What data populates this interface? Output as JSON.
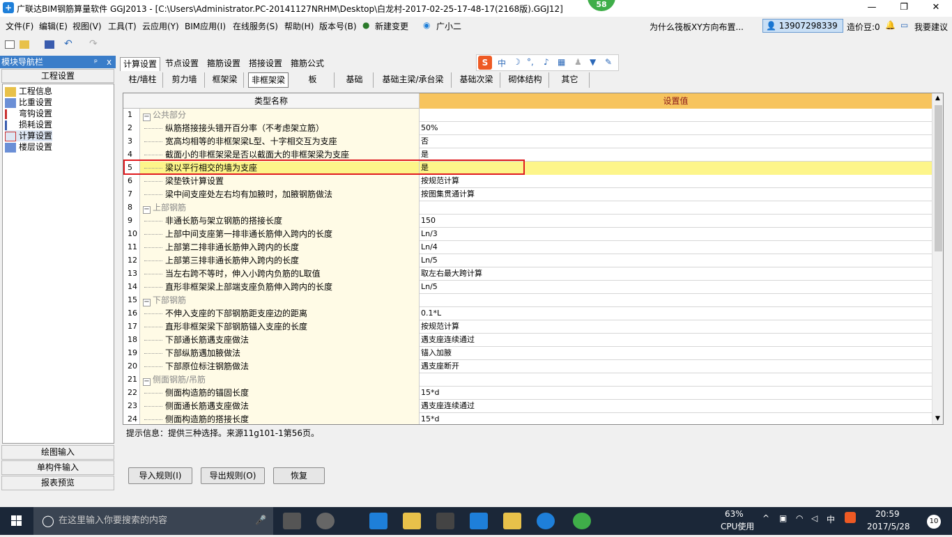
{
  "window": {
    "title": "广联达BIM钢筋算量软件 GGJ2013 - [C:\\Users\\Administrator.PC-20141127NRHM\\Desktop\\白龙村-2017-02-25-17-48-17(2168版).GGJ12]",
    "badge": "58",
    "minimize": "—",
    "maximize": "❐",
    "close": "✕"
  },
  "menubar": {
    "items": [
      "文件(F)",
      "编辑(E)",
      "视图(V)",
      "工具(T)",
      "云应用(Y)",
      "BIM应用(I)",
      "在线服务(S)",
      "帮助(H)",
      "版本号(B)",
      "新建变更",
      "广小二"
    ],
    "help_link": "为什么筏板XY方向布置...",
    "user": "13907298339",
    "coins": "造价豆:0",
    "suggest": "我要建议"
  },
  "nav": {
    "header": "模块导航栏",
    "pin": "ᵖ",
    "close": "x",
    "section": "工程设置",
    "items": [
      "工程信息",
      "比重设置",
      "弯钩设置",
      "损耗设置",
      "计算设置",
      "楼层设置"
    ],
    "bottom": [
      "绘图输入",
      "单构件输入",
      "报表预览"
    ]
  },
  "tabs_top": [
    "计算设置",
    "节点设置",
    "箍筋设置",
    "搭接设置",
    "箍筋公式"
  ],
  "tabs_sub": [
    "柱/墙柱",
    "剪力墙",
    "框架梁",
    "非框架梁",
    "板",
    "基础",
    "基础主梁/承台梁",
    "基础次梁",
    "砌体结构",
    "其它"
  ],
  "grid": {
    "col_name": "类型名称",
    "col_value": "设置值",
    "rows": [
      {
        "n": "1",
        "name": "公共部分",
        "value": "",
        "group": true
      },
      {
        "n": "2",
        "name": "纵筋搭接接头错开百分率（不考虑架立筋）",
        "value": "50%"
      },
      {
        "n": "3",
        "name": "宽高均相等的非框架梁L型、十字相交互为支座",
        "value": "否"
      },
      {
        "n": "4",
        "name": "截面小的非框架梁是否以截面大的非框架梁为支座",
        "value": "是"
      },
      {
        "n": "5",
        "name": "梁以平行相交的墙为支座",
        "value": "是",
        "highlight": true
      },
      {
        "n": "6",
        "name": "梁垫铁计算设置",
        "value": "按规范计算"
      },
      {
        "n": "7",
        "name": "梁中间支座处左右均有加腋时，加腋钢筋做法",
        "value": "按图集贯通计算"
      },
      {
        "n": "8",
        "name": "上部钢筋",
        "value": "",
        "group": true
      },
      {
        "n": "9",
        "name": "非通长筋与架立钢筋的搭接长度",
        "value": "150"
      },
      {
        "n": "10",
        "name": "上部中间支座第一排非通长筋伸入跨内的长度",
        "value": "Ln/3"
      },
      {
        "n": "11",
        "name": "上部第二排非通长筋伸入跨内的长度",
        "value": "Ln/4"
      },
      {
        "n": "12",
        "name": "上部第三排非通长筋伸入跨内的长度",
        "value": "Ln/5"
      },
      {
        "n": "13",
        "name": "当左右跨不等时，伸入小跨内负筋的L取值",
        "value": "取左右最大跨计算"
      },
      {
        "n": "14",
        "name": "直形非框架梁上部端支座负筋伸入跨内的长度",
        "value": "Ln/5"
      },
      {
        "n": "15",
        "name": "下部钢筋",
        "value": "",
        "group": true
      },
      {
        "n": "16",
        "name": "不伸入支座的下部钢筋距支座边的距离",
        "value": "0.1*L"
      },
      {
        "n": "17",
        "name": "直形非框架梁下部钢筋锚入支座的长度",
        "value": "按规范计算"
      },
      {
        "n": "18",
        "name": "下部通长筋遇支座做法",
        "value": "遇支座连续通过"
      },
      {
        "n": "19",
        "name": "下部纵筋遇加腋做法",
        "value": "锚入加腋"
      },
      {
        "n": "20",
        "name": "下部原位标注钢筋做法",
        "value": "遇支座断开"
      },
      {
        "n": "21",
        "name": "侧面钢筋/吊筋",
        "value": "",
        "group": true
      },
      {
        "n": "22",
        "name": "侧面构造筋的锚固长度",
        "value": "15*d"
      },
      {
        "n": "23",
        "name": "侧面通长筋遇支座做法",
        "value": "遇支座连续通过"
      },
      {
        "n": "24",
        "name": "侧面构造筋的搭接长度",
        "value": "15*d"
      }
    ]
  },
  "hint": "提示信息：提供三种选择。来源11g101-1第56页。",
  "buttons": {
    "import": "导入规则(I)",
    "export": "导出规则(O)",
    "restore": "恢复"
  },
  "taskbar": {
    "search_placeholder": "在这里输入你要搜索的内容",
    "cpu": "63%",
    "cpu_label": "CPU使用",
    "ime": "中",
    "time": "20:59",
    "date": "2017/5/28",
    "notify": "10"
  }
}
